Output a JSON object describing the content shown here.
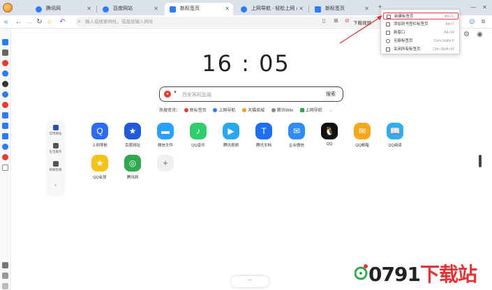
{
  "tabs": [
    {
      "label": "腾讯网",
      "color": "#2d7cf6",
      "active": false
    },
    {
      "label": "百度网站",
      "color": "#2d7cf6",
      "active": false
    },
    {
      "label": "新标签页",
      "color": "#2d7cf6",
      "active": true
    },
    {
      "label": "上网导航 - 轻松上网 从这里开始",
      "color": "#2d7cf6",
      "active": false
    },
    {
      "label": "新标签页",
      "color": "#2d7cf6",
      "active": false
    }
  ],
  "toolbar": {
    "address_placeholder": "输入或搜索网址，或直接输入网址",
    "user_label": "下载视频",
    "back_icon": "arrow-left-icon",
    "forward_icon": "arrow-right-icon",
    "refresh_icon": "refresh-icon",
    "home_icon": "home-icon"
  },
  "clock": "16 : 05",
  "search": {
    "placeholder": "西安客机坠毁",
    "button_label": "搜索"
  },
  "hot": {
    "prefix": "热搜资讯：",
    "items": [
      "新标签页",
      "上网导航",
      "天猫商城",
      "腾讯Wiki",
      "上网导航"
    ]
  },
  "categories": [
    {
      "label": "常用网站"
    },
    {
      "label": "生活服务"
    },
    {
      "label": "购物优惠"
    },
    {
      "label": "+"
    }
  ],
  "apps": [
    {
      "label": "上网导航",
      "color": "#2a6df4",
      "glyph": "Q"
    },
    {
      "label": "百度网址",
      "color": "#1f5bd8",
      "glyph": "★"
    },
    {
      "label": "微信文件",
      "color": "#2aa0ff",
      "glyph": "▬"
    },
    {
      "label": "QQ音乐",
      "color": "#2fcf6e",
      "glyph": "♪"
    },
    {
      "label": "腾讯视频",
      "color": "#28a8f0",
      "glyph": "▶"
    },
    {
      "label": "腾讯文档",
      "color": "#1e6ff0",
      "glyph": "T"
    },
    {
      "label": "企业微信",
      "color": "#2f8cf5",
      "glyph": "✉"
    },
    {
      "label": "QQ",
      "color": "#111111",
      "glyph": "🐧"
    },
    {
      "label": "QQ邮箱",
      "color": "#f3a81d",
      "glyph": "✉"
    },
    {
      "label": "QQ阅读",
      "color": "#2cb0f0",
      "glyph": "📖"
    },
    {
      "label": "QQ会员",
      "color": "#f5c21a",
      "glyph": "★"
    },
    {
      "label": "腾讯网",
      "color": "#2fa84f",
      "glyph": "◎"
    },
    {
      "label": "",
      "color": "#f0f0f0",
      "glyph": "+"
    }
  ],
  "menu": {
    "items": [
      {
        "label": "新建标签页",
        "shortcut": "Alt+S",
        "highlight": true
      },
      {
        "label": "添加到书签栏标签页",
        "shortcut": "Alt+T",
        "highlight": false
      },
      {
        "label": "新窗口",
        "shortcut": "Alt+W",
        "highlight": false
      },
      {
        "label": "无痕标签页",
        "shortcut": "Ctrl+Shift+S",
        "highlight": false
      },
      {
        "label": "关闭所有标签页",
        "shortcut": "Ctrl+Shift+W",
        "highlight": false
      }
    ]
  },
  "bottom_pill": "—",
  "watermark": {
    "digits": "0791",
    "cn": "下载站"
  }
}
